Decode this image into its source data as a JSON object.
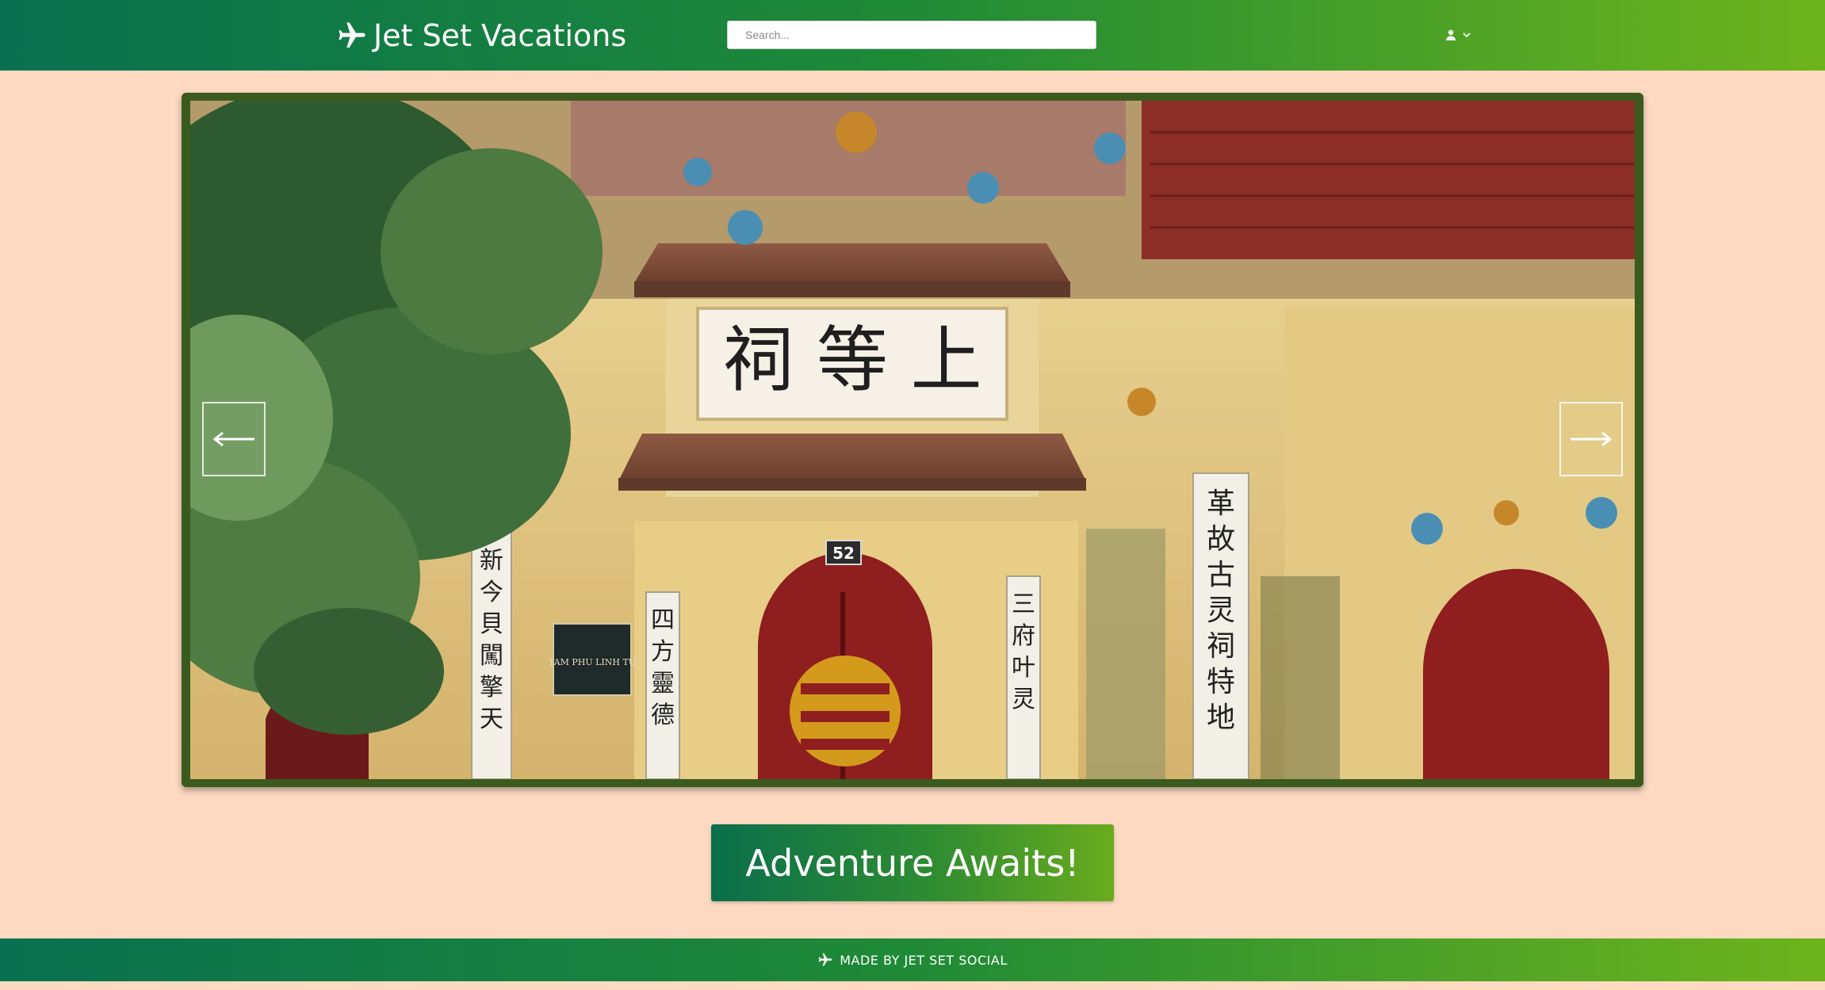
{
  "header": {
    "brand_name": "Jet Set Vacations",
    "brand_icon": "airplane-icon",
    "search_placeholder": "Search...",
    "user_icon": "user-icon",
    "dropdown_icon": "chevron-down-icon"
  },
  "carousel": {
    "sign_main": "上 等 祠",
    "house_number": "52",
    "plaque": "TAM PHU LINH TU",
    "prev_icon": "arrow-left-icon",
    "next_icon": "arrow-right-icon"
  },
  "cta": {
    "label": "Adventure Awaits!"
  },
  "footer": {
    "text": "MADE BY JET SET SOCIAL",
    "icon": "airplane-icon"
  },
  "colors": {
    "page_background": "#fcd9c0",
    "gradient_start": "#087150",
    "gradient_end": "#6eb41c",
    "carousel_frame": "#3a5a1e"
  }
}
